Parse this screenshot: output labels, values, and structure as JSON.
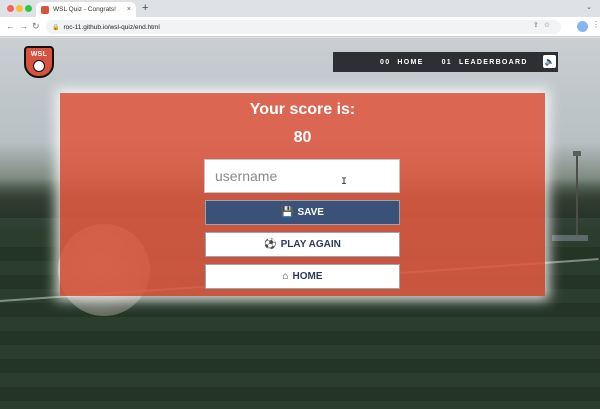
{
  "browser": {
    "tab_title": "WSL Quiz - Congrats!",
    "tab_close": "×",
    "new_tab": "+",
    "url": "roc-11.github.io/wsl-quiz/end.html"
  },
  "site": {
    "logo_text": "WSL",
    "nav": [
      {
        "num": "00",
        "label": "HOME"
      },
      {
        "num": "01",
        "label": "LEADERBOARD"
      }
    ],
    "sound_icon": "speaker-icon"
  },
  "result": {
    "heading": "Your score is:",
    "score": "80",
    "username_placeholder": "username",
    "save_label": "SAVE",
    "play_again_label": "PLAY AGAIN",
    "home_label": "HOME"
  },
  "colors": {
    "panel": "#df5a42",
    "save_button": "#3a5178",
    "nav_bar": "#2d2f32"
  }
}
